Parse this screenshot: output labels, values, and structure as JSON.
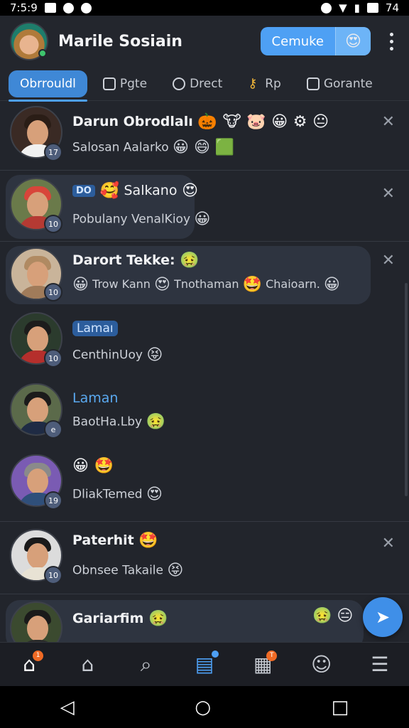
{
  "status_bar": {
    "time": "7:5:9",
    "battery": "74"
  },
  "header": {
    "title": "Marile Sosiain",
    "pill_label": "Cemuke",
    "pill_emoji": "😍"
  },
  "tabs": [
    {
      "label": "Obrrouldl",
      "icon": "chat-icon"
    },
    {
      "label": "Pgte",
      "icon": "page-icon"
    },
    {
      "label": "Drect",
      "icon": "heart-icon"
    },
    {
      "label": "Rp",
      "icon": "key-icon"
    },
    {
      "label": "Gorante",
      "icon": "message-icon"
    }
  ],
  "chats": [
    {
      "name": "Darun Obrodlalı",
      "name_emojis": "🎃 🐮 🐷 😀 ⚙ 😐",
      "message": "Salosan Aalarko",
      "message_emojis": "😀 😄 🟩",
      "badge": "17",
      "closable": true
    },
    {
      "name_tag": "DO",
      "name": "Salkano",
      "name_emojis_pre": "🥰",
      "name_emojis": "😍",
      "message": "Pobulany VenalKioy",
      "message_emojis": "😀",
      "badge": "10",
      "closable": true
    },
    {
      "name": "Darort Tekke:",
      "name_emojis": "🤢",
      "message": "Trow Kann",
      "message_2": "Tnothaman",
      "message_3": "Chaioarn.",
      "message_emojis": "😀",
      "badge": "10",
      "closable": true
    },
    {
      "name": "Lamaı",
      "message": "CenthinUoy",
      "message_emojis": "😝",
      "badge": "10",
      "closable": false
    },
    {
      "name": "Laman",
      "message": "BaotHa.Lby",
      "message_emojis": "🤢",
      "badge": "e",
      "closable": false
    },
    {
      "name": "",
      "name_emojis": "😀 🤩",
      "message": "DliakTemed",
      "message_emojis": "😍",
      "badge": "19",
      "closable": false
    },
    {
      "name": "Paterhit",
      "name_emojis": "🤩",
      "message": "Obnsee Takaile",
      "message_emojis": "😝",
      "badge": "10",
      "closable": true
    },
    {
      "name": "Gariarfim",
      "name_emojis": "🤢",
      "message": "",
      "message_emojis": "🤢 😑",
      "badge": "",
      "closable": false
    }
  ],
  "bottom_nav": [
    {
      "icon": "home-icon",
      "badge": "1"
    },
    {
      "icon": "market-icon",
      "badge": ""
    },
    {
      "icon": "search-icon",
      "badge": ""
    },
    {
      "icon": "chats-icon",
      "badge": "dot"
    },
    {
      "icon": "store-icon",
      "badge": "T"
    },
    {
      "icon": "profile-icon",
      "badge": ""
    },
    {
      "icon": "menu-icon",
      "badge": ""
    }
  ],
  "colors": {
    "accent": "#4ea0f4",
    "background": "#22252c",
    "bubble": "#2e3440"
  }
}
